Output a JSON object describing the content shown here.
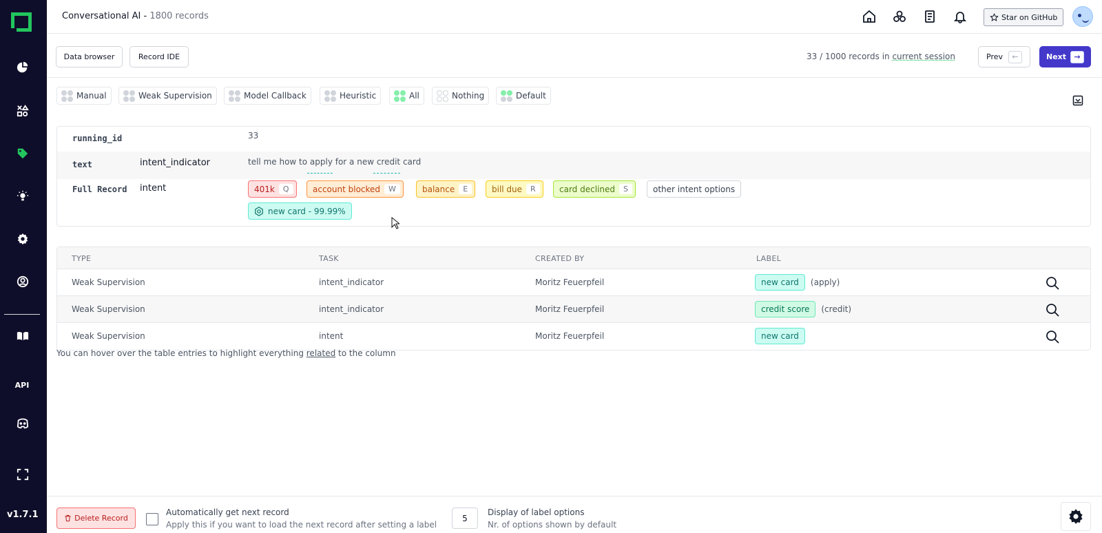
{
  "sidebar": {
    "api_label": "API",
    "version": "v1.7.1"
  },
  "header": {
    "project_name": "Conversational AI - ",
    "record_count": "1800 records",
    "star_label": "Star on GitHub"
  },
  "toolbar": {
    "data_browser": "Data browser",
    "record_ide": "Record IDE",
    "session_prefix": "33 / 1000 records in ",
    "session_link": "current session",
    "prev": "Prev",
    "next": "Next"
  },
  "filters": [
    "Manual",
    "Weak Supervision",
    "Model Callback",
    "Heuristic",
    "All",
    "Nothing",
    "Default"
  ],
  "record": {
    "running_id_key": "running_id",
    "running_id_value": "33",
    "text_key": "text",
    "text_task": "intent_indicator",
    "text_value": "tell me how to apply for a new credit card",
    "full_key": "Full Record",
    "full_task": "intent",
    "labels": [
      {
        "name": "401k",
        "key": "Q"
      },
      {
        "name": "account blocked",
        "key": "W"
      },
      {
        "name": "balance",
        "key": "E"
      },
      {
        "name": "bill due",
        "key": "R"
      },
      {
        "name": "card declined",
        "key": "S"
      }
    ],
    "other_options": "other intent options",
    "prediction": "new card - 99.99%"
  },
  "table": {
    "headers": [
      "TYPE",
      "TASK",
      "CREATED BY",
      "LABEL"
    ],
    "rows": [
      {
        "type": "Weak Supervision",
        "task": "intent_indicator",
        "created_by": "Moritz Feuerpfeil",
        "label": "new card",
        "source": "(apply)"
      },
      {
        "type": "Weak Supervision",
        "task": "intent_indicator",
        "created_by": "Moritz Feuerpfeil",
        "label": "credit score",
        "source": "(credit)"
      },
      {
        "type": "Weak Supervision",
        "task": "intent",
        "created_by": "Moritz Feuerpfeil",
        "label": "new card",
        "source": ""
      }
    ],
    "hint_prefix": "You can hover over the table entries to highlight everything ",
    "hint_link": "related",
    "hint_suffix": " to the column"
  },
  "bottom": {
    "delete": "Delete Record",
    "auto_title": "Automatically get next record",
    "auto_sub": "Apply this if you want to load the next record after setting a label",
    "num_options": "5",
    "display_title": "Display of label options",
    "display_sub": "Nr. of options shown by default"
  },
  "colors": {
    "sidebar": "#0f0e2a",
    "accent_green": "#22c55e",
    "primary": "#4338ca"
  }
}
